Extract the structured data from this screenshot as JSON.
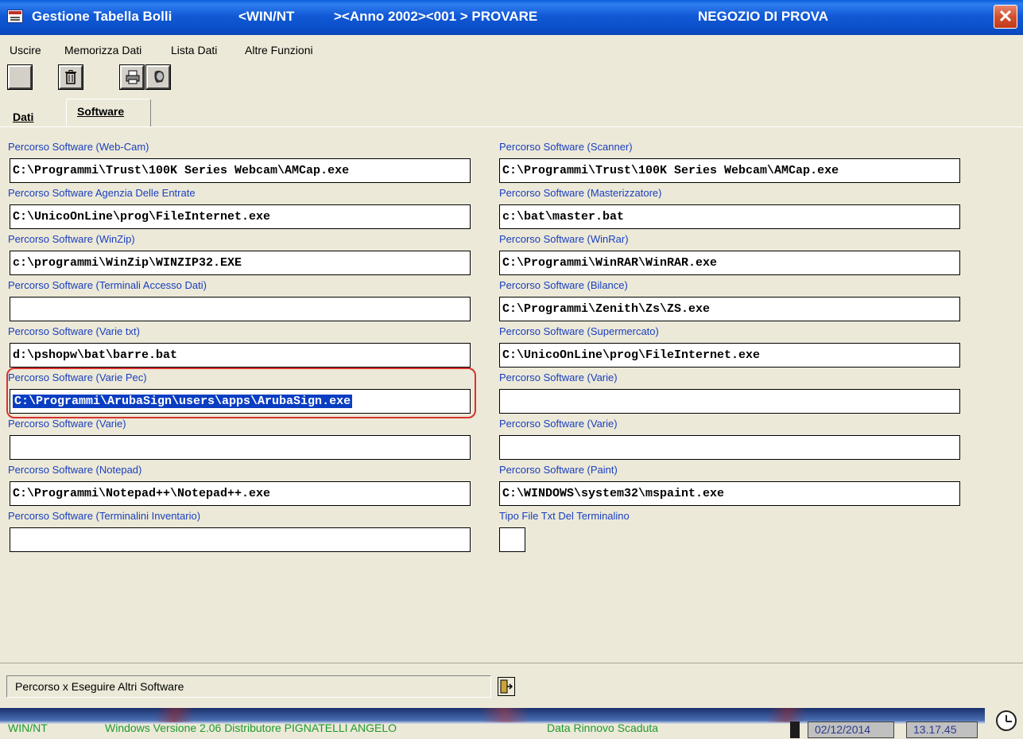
{
  "window": {
    "title": "Gestione Tabella Bolli",
    "platform": "<WIN/NT",
    "context": "><Anno 2002><001 > PROVARE",
    "store": "NEGOZIO DI PROVA",
    "close_glyph": "✕"
  },
  "menu": [
    "Uscire",
    "Memorizza Dati",
    "Lista Dati",
    "Altre Funzioni"
  ],
  "toolbar": [
    "blank-icon",
    "trash-icon",
    "printer-icon",
    "face-icon"
  ],
  "tabs": [
    {
      "label": "Dati",
      "active": false
    },
    {
      "label": "Software",
      "active": true
    }
  ],
  "fields_left": [
    {
      "label": "Percorso Software (Web-Cam)",
      "value": "C:\\Programmi\\Trust\\100K Series Webcam\\AMCap.exe"
    },
    {
      "label": "Percorso Software Agenzia Delle Entrate",
      "value": "C:\\UnicoOnLine\\prog\\FileInternet.exe"
    },
    {
      "label": "Percorso Software (WinZip)",
      "value": "c:\\programmi\\WinZip\\WINZIP32.EXE"
    },
    {
      "label": "Percorso Software (Terminali Accesso Dati)",
      "value": ""
    },
    {
      "label": "Percorso Software (Varie txt)",
      "value": "d:\\pshopw\\bat\\barre.bat"
    },
    {
      "label": "Percorso Software (Varie Pec)",
      "value": "C:\\Programmi\\ArubaSign\\users\\apps\\ArubaSign.exe",
      "selected": true
    },
    {
      "label": "Percorso Software (Varie)",
      "value": ""
    },
    {
      "label": "Percorso Software (Notepad)",
      "value": "C:\\Programmi\\Notepad++\\Notepad++.exe"
    },
    {
      "label": "Percorso Software (Terminalini Inventario)",
      "value": ""
    }
  ],
  "fields_right": [
    {
      "label": "Percorso Software (Scanner)",
      "value": "C:\\Programmi\\Trust\\100K Series Webcam\\AMCap.exe"
    },
    {
      "label": "Percorso Software (Masterizzatore)",
      "value": "c:\\bat\\master.bat"
    },
    {
      "label": "Percorso Software (WinRar)",
      "value": "C:\\Programmi\\WinRAR\\WinRAR.exe"
    },
    {
      "label": "Percorso Software (Bilance)",
      "value": "C:\\Programmi\\Zenith\\Zs\\ZS.exe"
    },
    {
      "label": "Percorso Software (Supermercato)",
      "value": "C:\\UnicoOnLine\\prog\\FileInternet.exe"
    },
    {
      "label": "Percorso Software (Varie)",
      "value": ""
    },
    {
      "label": "Percorso Software (Varie)",
      "value": ""
    },
    {
      "label": "Percorso Software (Paint)",
      "value": "C:\\WINDOWS\\system32\\mspaint.exe"
    },
    {
      "label": "Tipo File Txt Del Terminalino",
      "value": ""
    }
  ],
  "hint": "Percorso x Eseguire Altri Software",
  "status": {
    "platform": "WIN/NT",
    "version": "Windows   Versione 2.06 Distributore PIGNATELLI ANGELO",
    "renewal": "Data Rinnovo Scaduta",
    "date": "02/12/2014",
    "time": "13.17.45"
  },
  "colors": {
    "accent": "#0a3ec2",
    "label": "#1a3fbf",
    "status_text": "#2ecc40",
    "highlight": "#d9322f"
  }
}
